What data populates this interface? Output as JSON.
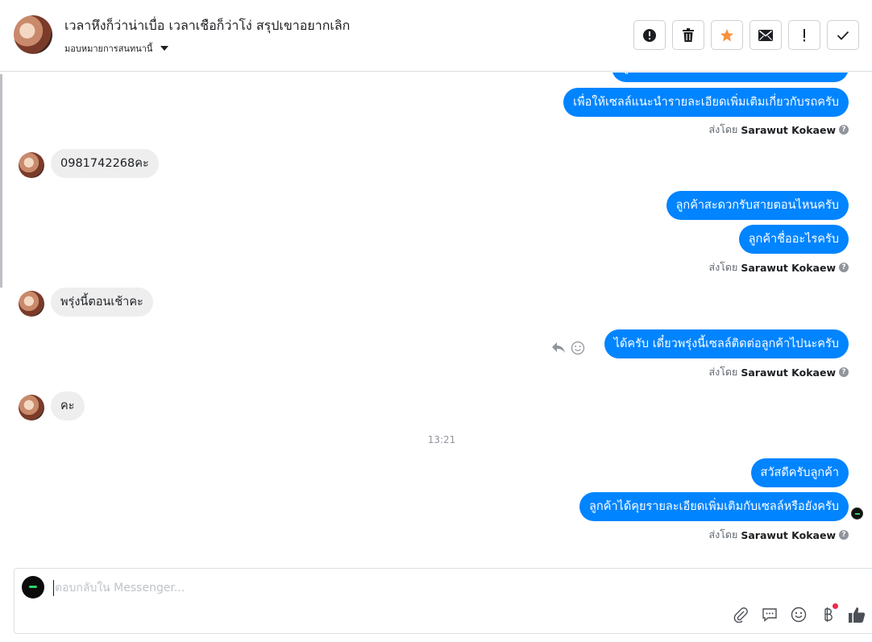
{
  "header": {
    "title": "เวลาหึงก็ว่าน่าเบื่อ เวลาเชือก็ว่าโง่ สรุปเขาอยากเลิก",
    "assign_label": "มอบหมายการสนทนานี้",
    "toolbar": [
      {
        "name": "alert-icon",
        "label": "Spam"
      },
      {
        "name": "trash-icon",
        "label": "Delete"
      },
      {
        "name": "star-icon",
        "label": "Star",
        "color": "#f7923b"
      },
      {
        "name": "mail-icon",
        "label": "Mark unread"
      },
      {
        "name": "exclamation-icon",
        "label": "Follow up"
      },
      {
        "name": "check-icon",
        "label": "Done"
      }
    ]
  },
  "messages": {
    "partial_top": "ลูกค้าสะดวกให้เซลล์ติดต่อกลับทางไหนครับ",
    "out1": "เพื่อให้เซลล์แนะนำรายละเอียดเพิ่มเติมเกี่ยวกับรถครับ",
    "sent_by_prefix": "ส่งโดย",
    "sent_by_name": "Sarawut Kokaew",
    "in1": "0981742268คะ",
    "out2": "ลูกค้าสะดวกรับสายตอนไหนครับ",
    "out3": "ลูกค้าชื่ออะไรครับ",
    "in2": "พรุ่งนี้ตอนเช้าคะ",
    "out4": "ได้ครับ เดี๋ยวพรุ่งนี้เซลล์ติดต่อลูกค้าไปนะครับ",
    "in3": "คะ",
    "time_separator": "13:21",
    "out5": "สวัสดีครับลูกค้า",
    "out6": "ลูกค้าได้คุยรายละเอียดเพิ่มเติมกับเซลล์หรือยังครับ"
  },
  "composer": {
    "placeholder": "ตอบกลับใน Messenger...",
    "value": "",
    "tools": [
      "attach-icon",
      "saved-reply-icon",
      "emoji-icon",
      "payment-icon",
      "like-icon"
    ]
  },
  "colors": {
    "outgoing_bubble": "#0084ff",
    "incoming_bubble": "#eeeeef",
    "notification_dot": "#f02849"
  }
}
